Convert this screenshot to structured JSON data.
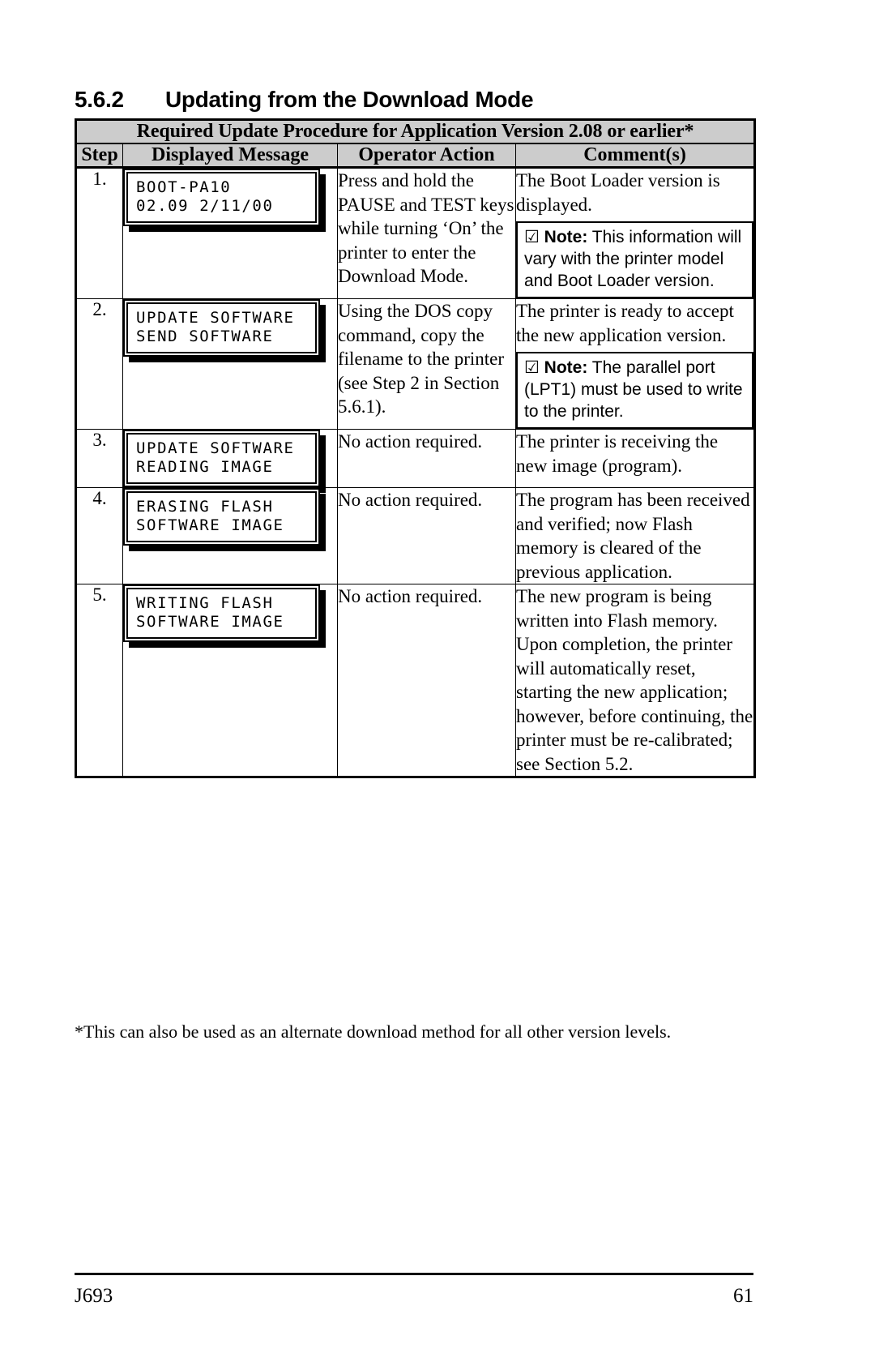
{
  "heading": {
    "number": "5.6.2",
    "title": "Updating from the Download Mode"
  },
  "table": {
    "title": "Required Update Procedure for Application Version 2.08 or earlier*",
    "columns": {
      "step": "Step",
      "message": "Displayed Message",
      "action": "Operator Action",
      "comment": "Comment(s)"
    },
    "rows": [
      {
        "step": "1.",
        "lcd_line1": "BOOT-PA10",
        "lcd_line2": "02.09 2/11/00",
        "action": "Press and hold the PAUSE and TEST keys while turning ‘On’ the printer to enter the Download Mode.",
        "comment": "The Boot Loader version is displayed.",
        "note": {
          "check": "☑",
          "label": "Note:",
          "text": " This information will vary with the printer model and Boot Loader version."
        }
      },
      {
        "step": "2.",
        "lcd_line1": "UPDATE SOFTWARE",
        "lcd_line2": "SEND SOFTWARE",
        "action": "Using the DOS copy command, copy the filename to the printer (see Step 2 in Section 5.6.1).",
        "comment": "The printer is ready to accept the new application version.",
        "note": {
          "check": "☑",
          "label": "Note:",
          "text": " The parallel port (LPT1) must be used to write to the printer."
        }
      },
      {
        "step": "3.",
        "lcd_line1": "UPDATE SOFTWARE",
        "lcd_line2": "READING IMAGE",
        "action": "No action required.",
        "comment": "The printer is receiving the new image (program).",
        "note": null
      },
      {
        "step": "4.",
        "lcd_line1": "ERASING FLASH",
        "lcd_line2": "SOFTWARE IMAGE",
        "action": "No action required.",
        "comment": "The program has been received and verified; now Flash memory is cleared of the previous application.",
        "note": null
      },
      {
        "step": "5.",
        "lcd_line1": "WRITING FLASH",
        "lcd_line2": "SOFTWARE IMAGE",
        "action": "No action required.",
        "comment": "The new program is being written into Flash memory. Upon completion, the printer will automatically reset, starting the new application; however, before continuing, the printer must be re-calibrated; see Section 5.2.",
        "note": null
      }
    ]
  },
  "footnote": "*This can also be used as an alternate download method for all other version levels.",
  "footer": {
    "left": "J693",
    "right": "61"
  }
}
